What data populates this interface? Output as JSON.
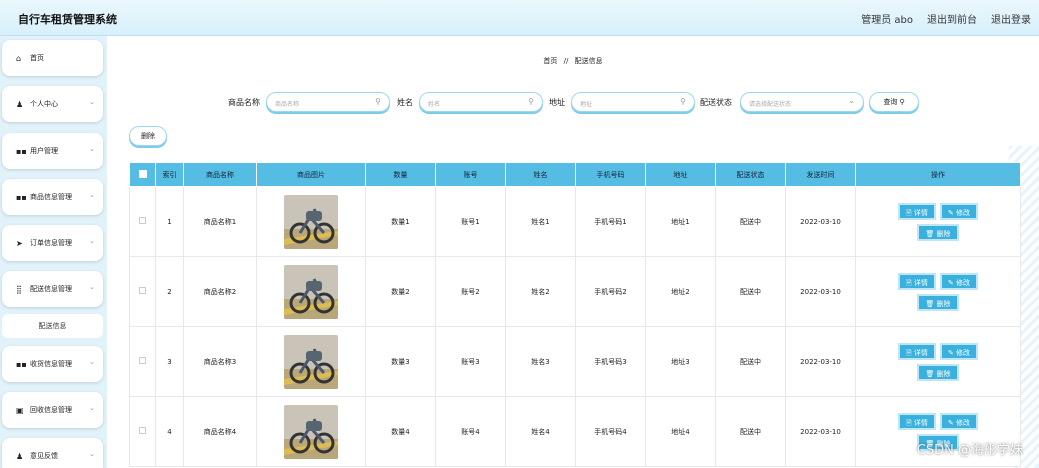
{
  "header": {
    "title": "自行车租赁管理系统",
    "user": "管理员 abo",
    "front_label": "退出到前台",
    "logout_label": "退出登录"
  },
  "sidebar": {
    "items": [
      {
        "label": "首页",
        "icon": "home-icon",
        "glyph": "⌂"
      },
      {
        "label": "个人中心",
        "icon": "user-icon",
        "glyph": "♟"
      },
      {
        "label": "用户管理",
        "icon": "grid-icon",
        "glyph": "▪▪"
      },
      {
        "label": "商品信息管理",
        "icon": "grid-icon",
        "glyph": "▪▪"
      },
      {
        "label": "订单信息管理",
        "icon": "send-icon",
        "glyph": "➤"
      },
      {
        "label": "配送信息管理",
        "icon": "apps-icon",
        "glyph": "⣿"
      },
      {
        "label": "收货信息管理",
        "icon": "grid-icon",
        "glyph": "▪▪"
      },
      {
        "label": "回收信息管理",
        "icon": "box-icon",
        "glyph": "▣"
      },
      {
        "label": "意见反馈",
        "icon": "user-icon",
        "glyph": "♟"
      }
    ],
    "subitem": "配送信息"
  },
  "breadcrumb": {
    "home": "首页",
    "sep": "//",
    "current": "配送信息"
  },
  "search": {
    "product_label": "商品名称",
    "product_placeholder": "商品名称",
    "name_label": "姓名",
    "name_placeholder": "姓名",
    "address_label": "地址",
    "address_placeholder": "地址",
    "status_label": "配送状态",
    "status_placeholder": "请选择配送状态",
    "query_label": "查询"
  },
  "delete_label": "删除",
  "table": {
    "headers": [
      "",
      "索引",
      "商品名称",
      "商品图片",
      "数量",
      "账号",
      "姓名",
      "手机号码",
      "地址",
      "配送状态",
      "发送时间",
      "操作"
    ],
    "rows": [
      {
        "index": "1",
        "product": "商品名称1",
        "qty": "数量1",
        "account": "账号1",
        "name": "姓名1",
        "phone": "手机号码1",
        "address": "地址1",
        "status": "配送中",
        "time": "2022-03-10"
      },
      {
        "index": "2",
        "product": "商品名称2",
        "qty": "数量2",
        "account": "账号2",
        "name": "姓名2",
        "phone": "手机号码2",
        "address": "地址2",
        "status": "配送中",
        "time": "2022-03-10"
      },
      {
        "index": "3",
        "product": "商品名称3",
        "qty": "数量3",
        "account": "账号3",
        "name": "姓名3",
        "phone": "手机号码3",
        "address": "地址3",
        "status": "配送中",
        "time": "2022-03-10"
      },
      {
        "index": "4",
        "product": "商品名称4",
        "qty": "数量4",
        "account": "账号4",
        "name": "姓名4",
        "phone": "手机号码4",
        "address": "地址4",
        "status": "配送中",
        "time": "2022-03-10"
      }
    ],
    "actions": {
      "detail": "详情",
      "edit": "修改",
      "delete": "删除"
    }
  },
  "watermark": "CSDN @海彤学妹",
  "colors": {
    "accent": "#3ab0de",
    "header_bg": "#55bde4"
  }
}
